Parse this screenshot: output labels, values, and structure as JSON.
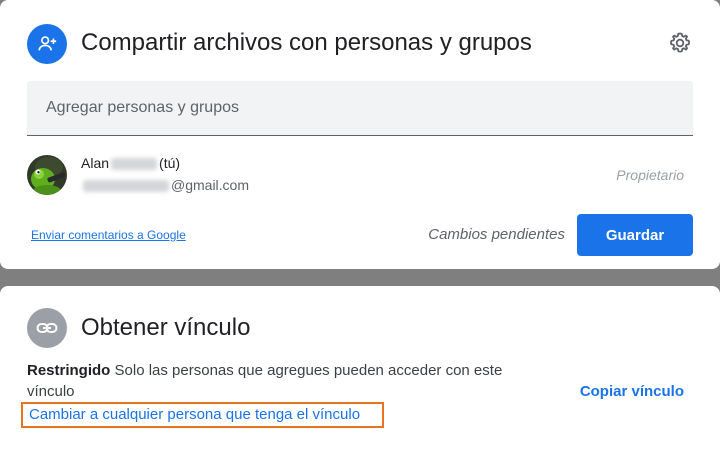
{
  "share_card": {
    "title": "Compartir archivos con personas y grupos",
    "icon": "person-add-icon",
    "settings_icon": "gear-icon",
    "add_field": {
      "placeholder": "Agregar personas y grupos",
      "value": ""
    },
    "people": [
      {
        "name_first": "Alan",
        "you_label": "(tú)",
        "email_suffix": "@gmail.com",
        "role": "Propietario"
      }
    ],
    "feedback_link": "Enviar comentarios a Google",
    "pending_text": "Cambios pendientes",
    "save_label": "Guardar"
  },
  "link_card": {
    "title": "Obtener vínculo",
    "icon": "link-icon",
    "access_level": "Restringido",
    "access_description": "Solo las personas que agregues pueden acceder con este vínculo",
    "change_link": "Cambiar a cualquier persona que tenga el vínculo",
    "copy_label": "Copiar vínculo"
  },
  "colors": {
    "accent": "#1a73e8",
    "highlight_outline": "#e8741f",
    "backdrop": "#7f7f7f"
  }
}
